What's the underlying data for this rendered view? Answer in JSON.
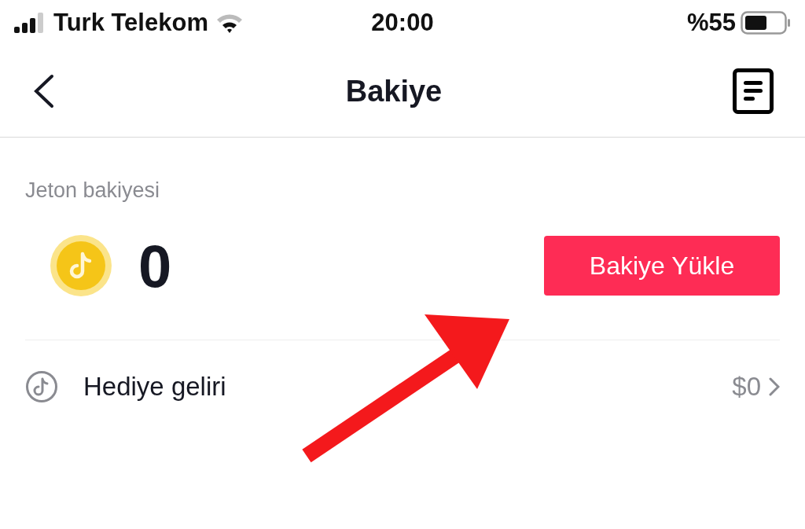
{
  "status_bar": {
    "carrier": "Turk Telekom",
    "time": "20:00",
    "battery": "%55"
  },
  "header": {
    "title": "Bakiye"
  },
  "balance": {
    "label": "Jeton bakiyesi",
    "amount": "0",
    "button": "Bakiye Yükle"
  },
  "rows": [
    {
      "label": "Hediye geliri",
      "value": "$0"
    }
  ],
  "annotation": {
    "kind": "arrow"
  }
}
